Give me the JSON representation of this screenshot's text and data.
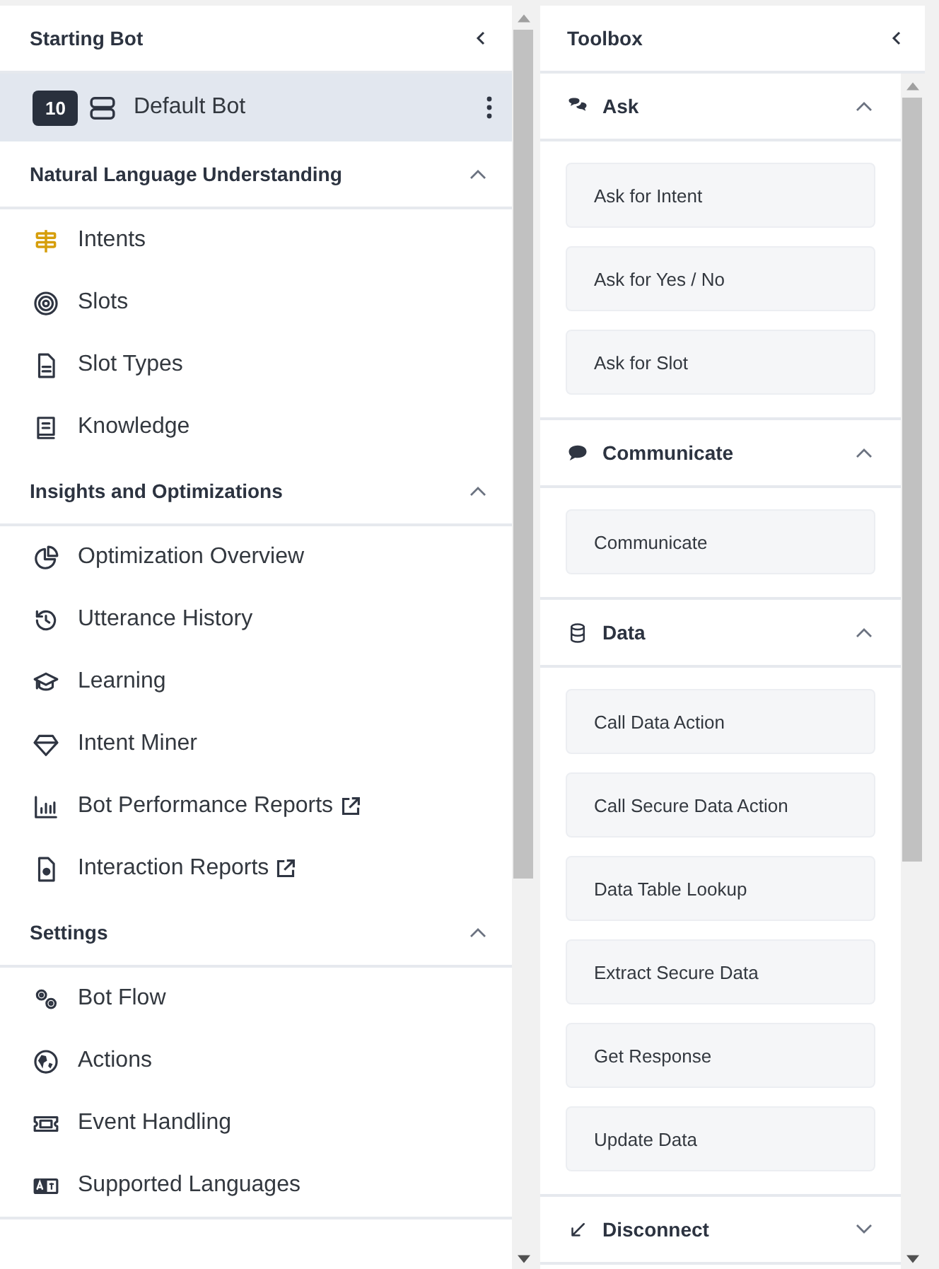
{
  "sidebar": {
    "title": "Starting Bot",
    "bot": {
      "version": "10",
      "name": "Default Bot",
      "selected": true
    },
    "sections": [
      {
        "title": "Natural Language Understanding",
        "expanded": true,
        "items": [
          {
            "label": "Intents",
            "selected": false,
            "external": false
          },
          {
            "label": "Slots",
            "selected": false,
            "external": false
          },
          {
            "label": "Slot Types",
            "selected": false,
            "external": false
          },
          {
            "label": "Knowledge",
            "selected": false,
            "external": false
          }
        ]
      },
      {
        "title": "Insights and Optimizations",
        "expanded": true,
        "items": [
          {
            "label": "Optimization Overview",
            "selected": false,
            "external": false
          },
          {
            "label": "Utterance History",
            "selected": false,
            "external": false
          },
          {
            "label": "Learning",
            "selected": false,
            "external": false
          },
          {
            "label": "Intent Miner",
            "selected": false,
            "external": false
          },
          {
            "label": "Bot Performance Reports",
            "selected": false,
            "external": true
          },
          {
            "label": "Interaction Reports",
            "selected": false,
            "external": true
          }
        ]
      },
      {
        "title": "Settings",
        "expanded": true,
        "items": [
          {
            "label": "Bot Flow",
            "selected": false,
            "external": false
          },
          {
            "label": "Actions",
            "selected": false,
            "external": false
          },
          {
            "label": "Event Handling",
            "selected": false,
            "external": false
          },
          {
            "label": "Supported Languages",
            "selected": false,
            "external": false
          }
        ]
      }
    ]
  },
  "toolbox": {
    "title": "Toolbox",
    "sections": [
      {
        "title": "Ask",
        "expanded": true,
        "items": [
          "Ask for Intent",
          "Ask for Yes / No",
          "Ask for Slot"
        ]
      },
      {
        "title": "Communicate",
        "expanded": true,
        "items": [
          "Communicate"
        ]
      },
      {
        "title": "Data",
        "expanded": true,
        "items": [
          "Call Data Action",
          "Call Secure Data Action",
          "Data Table Lookup",
          "Extract Secure Data",
          "Get Response",
          "Update Data"
        ]
      },
      {
        "title": "Disconnect",
        "expanded": false
      }
    ]
  }
}
